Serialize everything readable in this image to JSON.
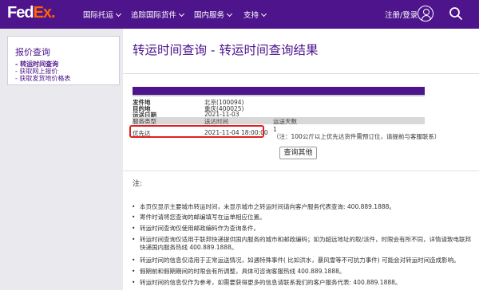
{
  "header": {
    "logo_fed": "Fed",
    "logo_ex": "Ex.",
    "nav": [
      "国际托运",
      "追踪国际货件",
      "国内服务",
      "支持"
    ],
    "login": "注册/登录",
    "user_icon": "user-icon",
    "search_icon": "search-icon"
  },
  "sidebar": {
    "title": "报价查询",
    "items": [
      "- 转运时间查询",
      "- 获取网上报价",
      "- 获取发货地价格表"
    ]
  },
  "page": {
    "title": "转运时间查询 - 转运时间查询结果"
  },
  "shipment": {
    "origin_label": "发件地",
    "origin_value": "北京(100094)",
    "destination_label": "目的地",
    "destination_value": "重庆(400025)",
    "ship_date_label": "运送日期",
    "ship_date_value": "2021-11-03"
  },
  "table": {
    "headers": [
      "服务类型",
      "送达时间",
      "运送天数"
    ],
    "rows": [
      {
        "service": "优先达",
        "delivery_time": "2021-11-04 18:00:00",
        "days": "1",
        "note": "（注：100公斤以上优先达货件需预订位，请提前与客服联系）"
      }
    ]
  },
  "actions": {
    "search_again": "查询其他"
  },
  "notes": {
    "title": "注:",
    "items": [
      "本页仅显示主要城市转运时间，未显示城市之转运时间请向客户服务代表查询: 400.889.1888。",
      "寄件时请将您查询的邮编填写在运单相应位置。",
      "转运时间查询仅使用邮政编码作为查询条件。",
      "转运时间查询仅适用于联邦快递提供国内服务的城市和邮政编码；如为超远地址的取/派件，时限会有所不同，详情请致电联邦快递国内服务热线 400.889.1888。",
      "转运时间的信息仅适用于正常运送情况，如遇特殊事件( 比如洪水，暴风雪等不可抗力事件) 可能会对转运时间造成影响。",
      "假期前和假期期间的时限会有所调整，具体可咨询客服热线 400.889.1888。",
      "转运时间的信息仅作为参考，如需要获得更多的信息请联系我们的客户服务代表: 400.889.1888。"
    ]
  },
  "colors": {
    "brand_purple": "#4d148c",
    "brand_orange": "#ff6200",
    "highlight_red": "#e02020"
  }
}
